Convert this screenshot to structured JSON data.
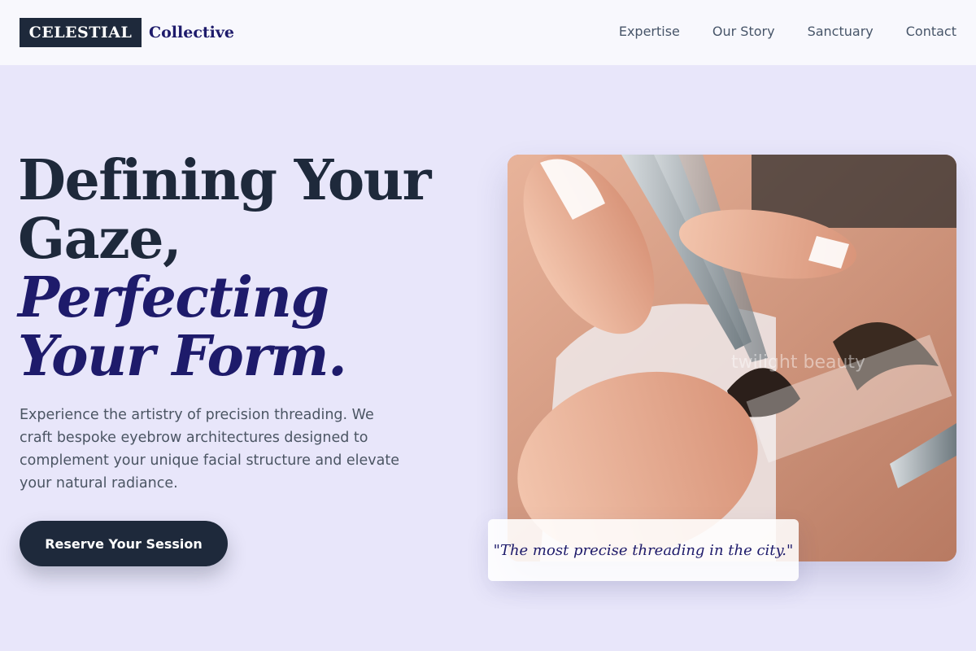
{
  "brand": {
    "box": "CELESTIAL",
    "word": "Collective"
  },
  "nav": {
    "items": [
      "Expertise",
      "Our Story",
      "Sanctuary",
      "Contact"
    ]
  },
  "hero": {
    "line1": "Defining Your Gaze,",
    "line2": "Perfecting Your Form.",
    "description": "Experience the artistry of precision threading. We craft bespoke eyebrow architectures designed to complement your unique facial structure and elevate your natural radiance.",
    "cta": "Reserve Your Session"
  },
  "photo": {
    "watermark": "twilight beauty"
  },
  "quote": "\"The most precise threading in the city.\"",
  "colors": {
    "accent": "#1e1b6b",
    "dark": "#1e293b",
    "background": "#e8e6fa"
  }
}
